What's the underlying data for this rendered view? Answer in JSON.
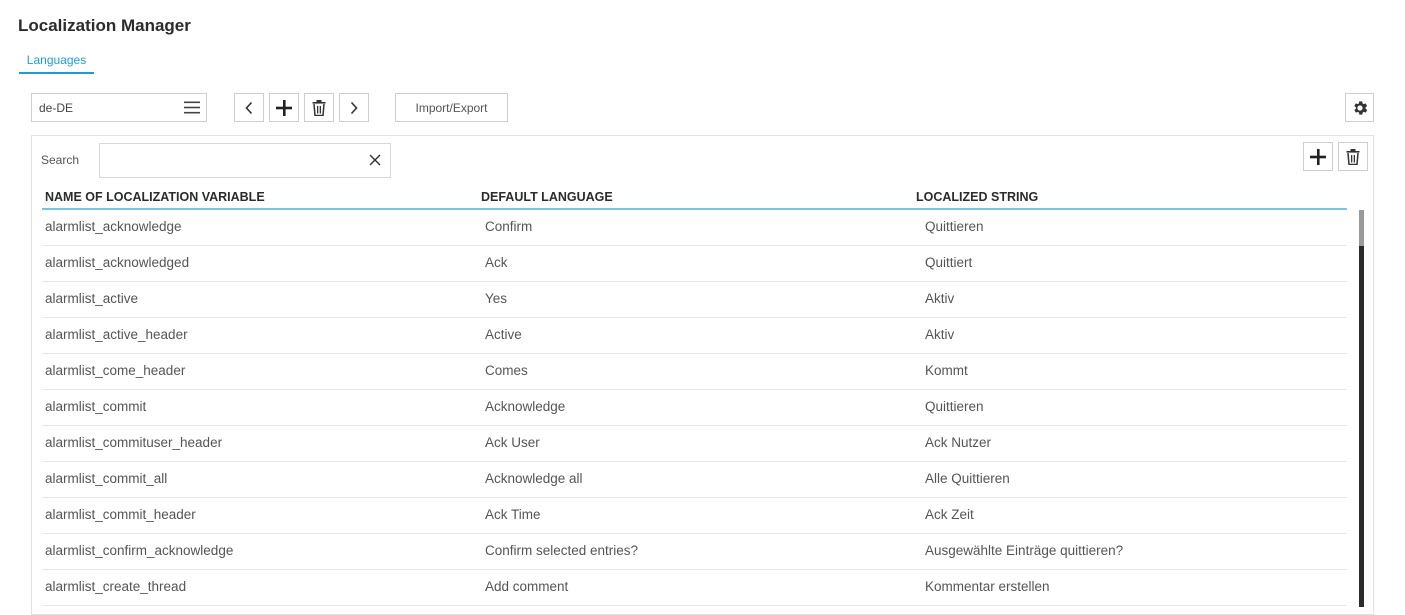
{
  "app": {
    "title": "Localization Manager"
  },
  "tabs": [
    {
      "label": "Languages",
      "active": true
    }
  ],
  "toolbar": {
    "language_value": "de-DE",
    "import_export_label": "Import/Export"
  },
  "search": {
    "label": "Search",
    "value": ""
  },
  "table": {
    "columns": [
      "NAME OF LOCALIZATION VARIABLE",
      "DEFAULT LANGUAGE",
      "LOCALIZED STRING"
    ],
    "rows": [
      [
        "alarmlist_acknowledge",
        "Confirm",
        "Quittieren"
      ],
      [
        "alarmlist_acknowledged",
        "Ack",
        "Quittiert"
      ],
      [
        "alarmlist_active",
        "Yes",
        "Aktiv"
      ],
      [
        "alarmlist_active_header",
        "Active",
        "Aktiv"
      ],
      [
        "alarmlist_come_header",
        "Comes",
        "Kommt"
      ],
      [
        "alarmlist_commit",
        "Acknowledge",
        "Quittieren"
      ],
      [
        "alarmlist_commituser_header",
        "Ack User",
        "Ack Nutzer"
      ],
      [
        "alarmlist_commit_all",
        "Acknowledge all",
        "Alle Quittieren"
      ],
      [
        "alarmlist_commit_header",
        "Ack Time",
        "Ack Zeit"
      ],
      [
        "alarmlist_confirm_acknowledge",
        "Confirm selected entries?",
        "Ausgewählte Einträge quittieren?"
      ],
      [
        "alarmlist_create_thread",
        "Add comment",
        "Kommentar erstellen"
      ]
    ]
  },
  "colors": {
    "accent": "#1a9ed9",
    "header_rule": "#7cc3e3",
    "text": "#555555"
  }
}
